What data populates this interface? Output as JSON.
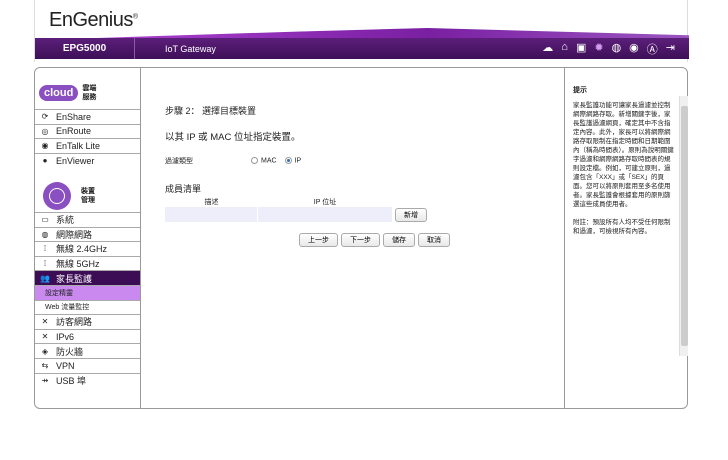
{
  "header": {
    "logo": "EnGenius",
    "model": "EPG5000",
    "product": "IoT Gateway",
    "icons": [
      "cloud-download-icon",
      "home-icon",
      "wizard-icon",
      "gear-icon",
      "globe-icon",
      "location-icon",
      "account-icon",
      "logout-icon"
    ]
  },
  "sidebar": {
    "cloud_title": "雲端服務",
    "cloud_logo": "cloud",
    "cloud_items": [
      {
        "label": "EnShare",
        "icon": "⟳"
      },
      {
        "label": "EnRoute",
        "icon": "◎"
      },
      {
        "label": "EnTalk Lite",
        "icon": "◉"
      },
      {
        "label": "EnViewer",
        "icon": "●"
      }
    ],
    "device_title": "裝置管理",
    "items": [
      {
        "label": "系統",
        "icon": "▭"
      },
      {
        "label": "網際網路",
        "icon": "◍"
      },
      {
        "label": "無線 2.4GHz",
        "icon": "⁞"
      },
      {
        "label": "無線 5GHz",
        "icon": "⁞"
      },
      {
        "label": "家長監護",
        "icon": "👥"
      },
      {
        "label": "設定精靈"
      },
      {
        "label": "Web 流量監控"
      },
      {
        "label": "訪客網路",
        "icon": "✕"
      },
      {
        "label": "IPv6",
        "icon": "✕"
      },
      {
        "label": "防火牆",
        "icon": "◈"
      },
      {
        "label": "VPN",
        "icon": "⇆"
      },
      {
        "label": "USB 埠",
        "icon": "⇸"
      }
    ]
  },
  "main": {
    "step": "步驟 2： 選擇目標裝置",
    "desc": "以其 IP 或 MAC 位址指定裝置。",
    "filter_label": "過濾類型",
    "opt_mac": "MAC",
    "opt_ip": "IP",
    "selected": "IP",
    "list_title": "成員清單",
    "col_desc": "描述",
    "col_ip": "IP 位址",
    "add": "新增",
    "prev": "上一步",
    "next": "下一步",
    "save": "儲存",
    "cancel": "取消"
  },
  "hint": {
    "title": "提示",
    "body": "家長監護功能可讓家長過濾並控制網際網路存取。新增關鍵字後，家長監護過濾網頁，確定其中不含指定內容。此外，家長可以將網際網路存取限制在指定時間和日期範圍內（稱為時間表）。原則為說明關鍵字過濾和網際網路存取時間表的規則設定檔。例如，可建立原則，過濾包含「XXX」或「SEX」的頁面。您可以將原則套用至多名使用者。家長監護會根據套用的原則篩選這些成員使用者。",
    "note": "附註：預設所有人均不受任何限制和過濾，可檢視所有內容。"
  }
}
